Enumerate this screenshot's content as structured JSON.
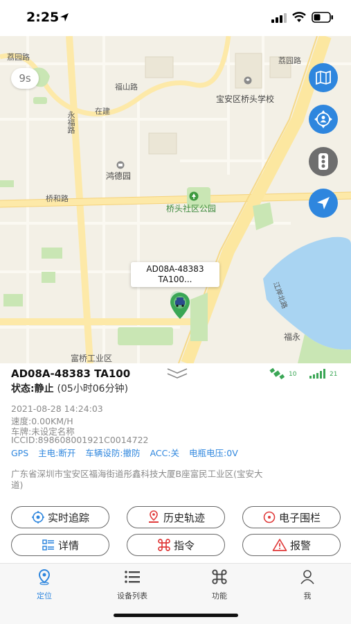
{
  "status_bar": {
    "time": "2:25"
  },
  "map": {
    "timer": "9s",
    "labels": {
      "lizhou_rd": "荔园路",
      "fushan_rd": "福山路",
      "zaijian": "在建",
      "yongfu_rd": "永福路",
      "hongde_park": "鸿德园",
      "qiaohe_rd": "桥和路",
      "qiaotou_park": "桥头社区公园",
      "school": "宝安区桥头学校",
      "ludong_rd": "荔园路",
      "fuyong": "福永",
      "fuqiao": "富桥工业区",
      "river_rd": "江岸北路"
    },
    "callout": {
      "line1": "AD08A-48383",
      "line2": "TA100..."
    }
  },
  "device": {
    "plate": "AD08A-48383 TA100",
    "status_label": "状态:静止",
    "status_duration": "(05小时06分钟)",
    "gps_count": "10",
    "signal_count": "21",
    "datetime": "2021-08-28 14:24:03",
    "speed": "速度:0.00KM/H",
    "car_plate": "车牌:未设定名称",
    "iccid": "ICCID:898608001921C0014722",
    "flags": [
      "GPS",
      "主电:断开",
      "车辆设防:撤防",
      "ACC:关",
      "电瓶电压:0V"
    ],
    "address": "广东省深圳市宝安区福海街道彤鑫科技大厦B座富民工业区(宝安大道)"
  },
  "actions": {
    "realtime": "实时追踪",
    "history": "历史轨迹",
    "fence": "电子围栏",
    "detail": "详情",
    "command": "指令",
    "alarm": "报警"
  },
  "tabs": {
    "locate": "定位",
    "devices": "设备列表",
    "functions": "功能",
    "me": "我"
  },
  "colors": {
    "accent": "#2e86de",
    "marker": "#3aa655",
    "alert": "#e03a3a"
  }
}
